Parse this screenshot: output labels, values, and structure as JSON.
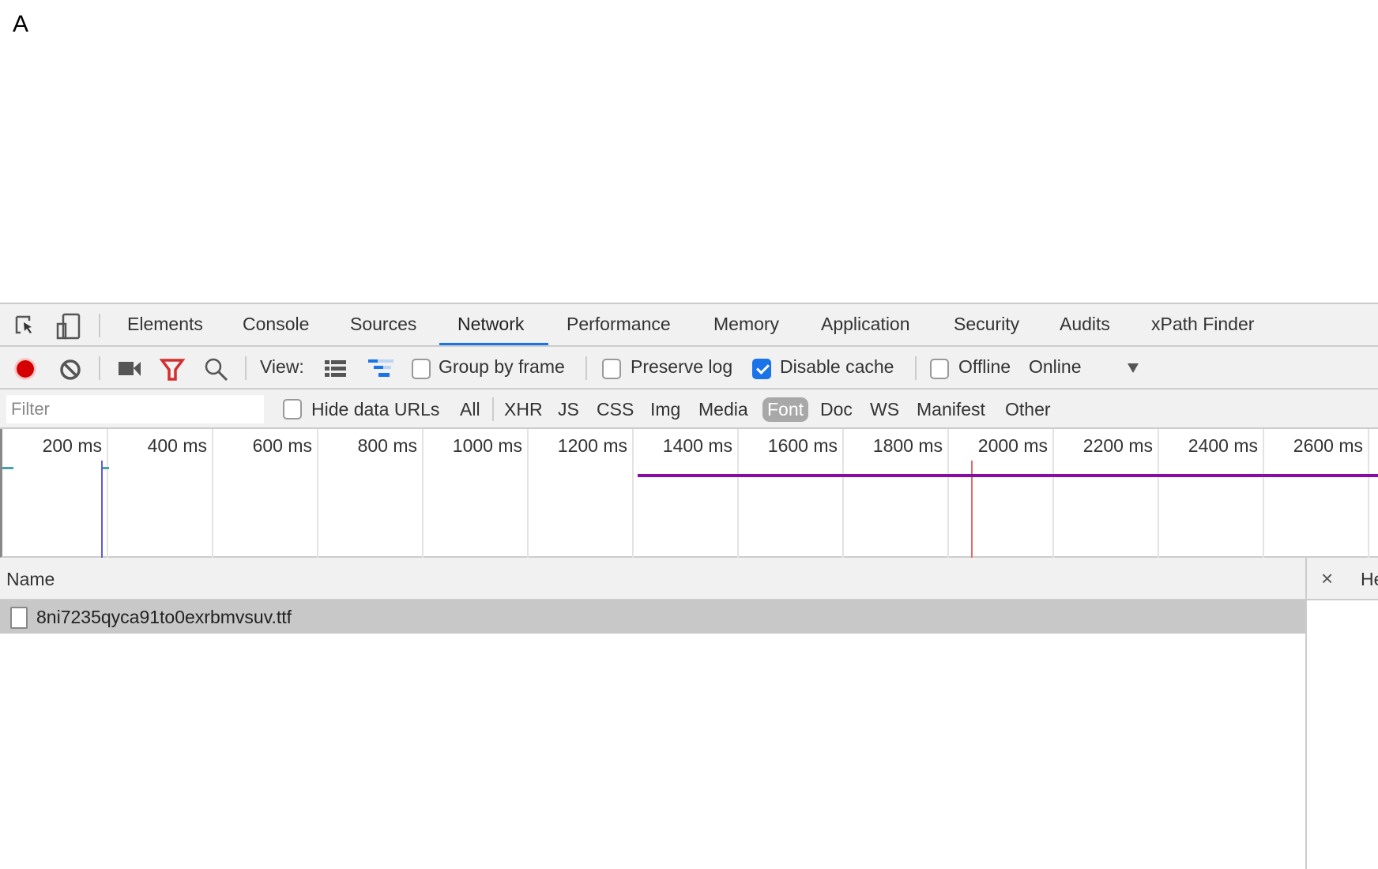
{
  "page": {
    "letter": "A"
  },
  "tabs": [
    "Elements",
    "Console",
    "Sources",
    "Network",
    "Performance",
    "Memory",
    "Application",
    "Security",
    "Audits",
    "xPath Finder"
  ],
  "active_tab": "Network",
  "toolbar": {
    "view_label": "View:",
    "group_by_frame": "Group by frame",
    "group_by_frame_checked": false,
    "preserve_log": "Preserve log",
    "preserve_log_checked": false,
    "disable_cache": "Disable cache",
    "disable_cache_checked": true,
    "offline": "Offline",
    "offline_checked": false,
    "throttling": "Online"
  },
  "filterbar": {
    "placeholder": "Filter",
    "hide_data_urls": "Hide data URLs",
    "types": [
      "All",
      "XHR",
      "JS",
      "CSS",
      "Img",
      "Media",
      "Font",
      "Doc",
      "WS",
      "Manifest",
      "Other"
    ],
    "active_type": "Font"
  },
  "timeline": {
    "ticks": [
      "200 ms",
      "400 ms",
      "600 ms",
      "800 ms",
      "1000 ms",
      "1200 ms",
      "1400 ms",
      "1600 ms",
      "1800 ms",
      "2000 ms",
      "2200 ms",
      "2400 ms",
      "2600 ms"
    ],
    "dom_content_loaded_ms": 190,
    "load_ms": 1845,
    "request_start_ms": 1210
  },
  "table": {
    "name_header": "Name",
    "rows": [
      {
        "name": "8ni7235qyca91to0exrbmvsuv.ttf"
      }
    ]
  },
  "detail": {
    "close": "×",
    "headers_tab": "He"
  },
  "colors": {
    "accent": "#1a73e8",
    "record": "#d50000",
    "filter_icon": "#d32f2f",
    "request_bar": "#8a0aa4",
    "load_line": "#e46a6a",
    "dcl_line": "#5a5ae6"
  }
}
